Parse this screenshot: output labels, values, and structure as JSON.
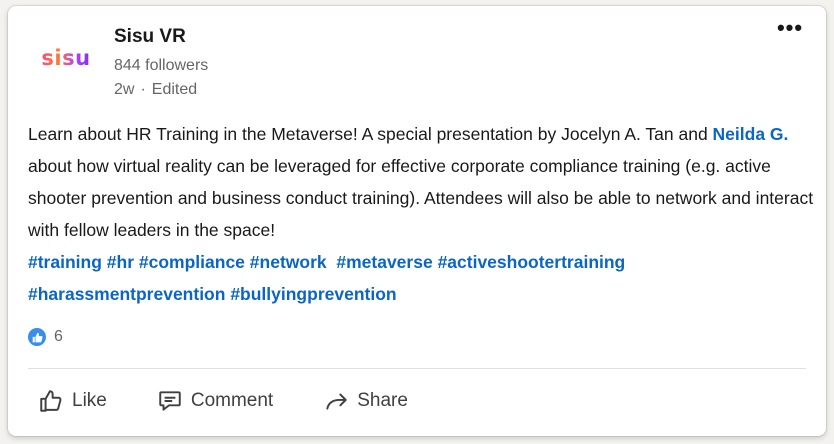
{
  "post": {
    "logo_text": "sisu",
    "author": "Sisu VR",
    "followers": "844 followers",
    "age": "2w",
    "edited": "Edited",
    "more_label": "•••",
    "text_part1": "Learn about HR Training in the Metaverse! A special presentation by Jocelyn A. Tan and ",
    "mention": "Neilda G.",
    "text_part2": " about how virtual reality can be leveraged for effective corporate compliance training (e.g. active shooter prevention and business conduct training). Attendees will also be able to network and interact with fellow leaders in the space!",
    "hashtags": [
      "#training",
      "#hr",
      "#compliance",
      "#network",
      "#metaverse",
      "#activeshootertraining",
      "#harassmentprevention",
      "#bullyingprevention"
    ],
    "reaction_count": "6"
  },
  "actions": {
    "like": "Like",
    "comment": "Comment",
    "share": "Share"
  },
  "colors": {
    "link": "#0a66c2",
    "like_badge": "#378fe9"
  },
  "icons": {
    "like": "thumbs-up-icon",
    "comment": "comment-icon",
    "share": "share-arrow-icon"
  }
}
